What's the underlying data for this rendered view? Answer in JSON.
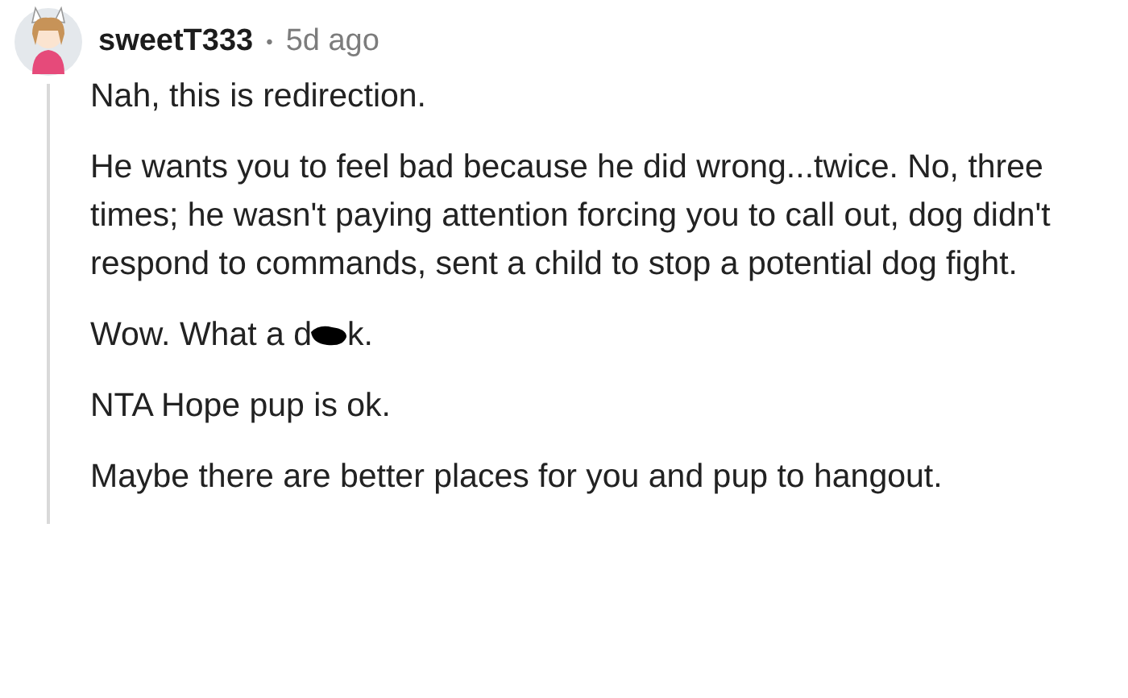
{
  "comment": {
    "author": "sweetT333",
    "separator": "•",
    "time": "5d ago",
    "paragraphs": [
      {
        "kind": "text",
        "text": "Nah, this is redirection."
      },
      {
        "kind": "text",
        "text": "He wants you to feel bad because he did wrong...twice. No, three times; he wasn't paying attention forcing you to call out, dog didn't respond to commands, sent a child to stop a potential dog fight."
      },
      {
        "kind": "redacted",
        "before": "Wow. What a d",
        "after": "k."
      },
      {
        "kind": "text",
        "text": "NTA Hope pup is ok."
      },
      {
        "kind": "text",
        "text": "Maybe there are better places for you and pup to hangout."
      }
    ]
  }
}
